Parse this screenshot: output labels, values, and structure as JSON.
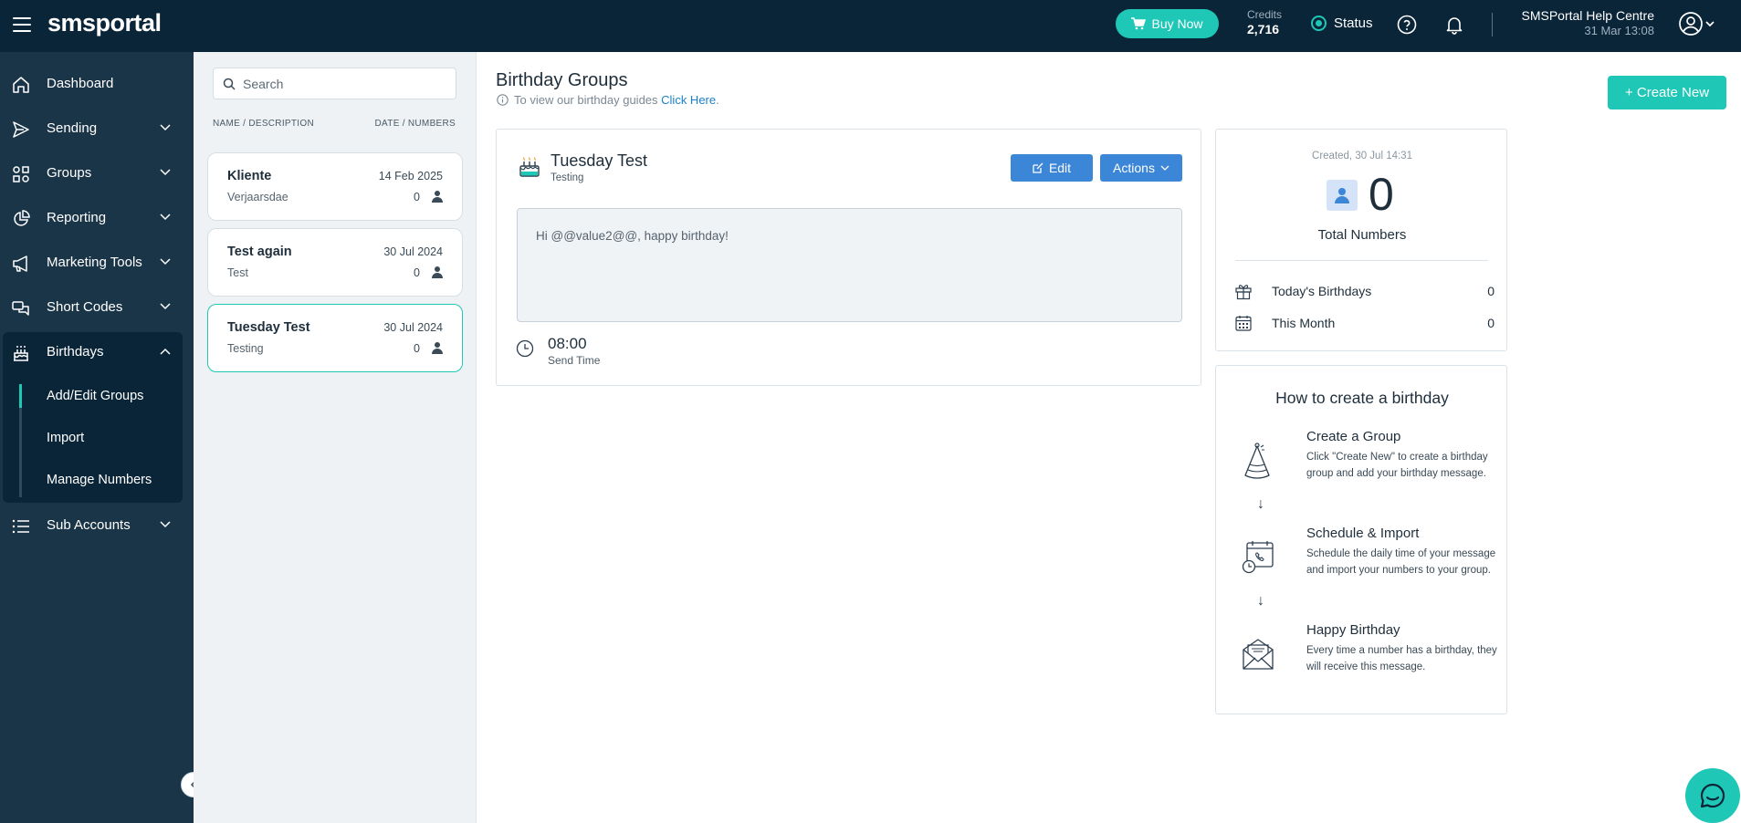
{
  "header": {
    "logo": "smsportal",
    "buy_now": "Buy Now",
    "credits_label": "Credits",
    "credits_value": "2,716",
    "status_label": "Status",
    "help_title": "SMSPortal Help Centre",
    "help_date": "31 Mar 13:08"
  },
  "sidebar": {
    "items": [
      {
        "label": "Dashboard",
        "icon": "home-icon"
      },
      {
        "label": "Sending",
        "icon": "send-icon"
      },
      {
        "label": "Groups",
        "icon": "groups-icon"
      },
      {
        "label": "Reporting",
        "icon": "pie-chart-icon"
      },
      {
        "label": "Marketing Tools",
        "icon": "megaphone-icon"
      },
      {
        "label": "Short Codes",
        "icon": "chat-icon"
      },
      {
        "label": "Birthdays",
        "icon": "cake-icon"
      },
      {
        "label": "Sub Accounts",
        "icon": "list-icon"
      }
    ],
    "birthday_sub": [
      {
        "label": "Add/Edit Groups",
        "active": true
      },
      {
        "label": "Import",
        "active": false
      },
      {
        "label": "Manage Numbers",
        "active": false
      }
    ]
  },
  "list": {
    "search_placeholder": "Search",
    "col_left": "NAME / DESCRIPTION",
    "col_right": "DATE / NUMBERS",
    "groups": [
      {
        "name": "Kliente",
        "date": "14 Feb 2025",
        "desc": "Verjaarsdae",
        "count": "0"
      },
      {
        "name": "Test again",
        "date": "30 Jul 2024",
        "desc": "Test",
        "count": "0"
      },
      {
        "name": "Tuesday Test",
        "date": "30 Jul 2024",
        "desc": "Testing",
        "count": "0",
        "selected": true
      }
    ]
  },
  "main": {
    "title": "Birthday Groups",
    "guide_text": "To view our birthday guides",
    "guide_link": "Click Here",
    "guide_end": ".",
    "create_new": "+ Create New"
  },
  "detail": {
    "name": "Tuesday Test",
    "desc": "Testing",
    "edit": "Edit",
    "actions": "Actions",
    "message": "Hi @@value2@@, happy birthday!",
    "send_time": "08:00",
    "send_time_label": "Send Time"
  },
  "stats": {
    "created": "Created, 30 Jul 14:31",
    "total": "0",
    "total_label": "Total Numbers",
    "today_label": "Today's Birthdays",
    "today_value": "0",
    "month_label": "This Month",
    "month_value": "0"
  },
  "howto": {
    "title": "How to create a birthday",
    "steps": [
      {
        "title": "Create a Group",
        "body": "Click \"Create New\" to create a birthday group and add your birthday message.",
        "icon": "party-hat-icon"
      },
      {
        "title": "Schedule & Import",
        "body": "Schedule the daily time of your message and import your numbers to your group.",
        "icon": "calendar-clock-icon"
      },
      {
        "title": "Happy Birthday",
        "body": "Every time a number has a birthday, they will receive this message.",
        "icon": "envelope-icon"
      }
    ],
    "arrow": "↓"
  },
  "colors": {
    "accent": "#1fc7b6",
    "topbar": "#0b2538",
    "sidebar": "#1b3548",
    "button_blue": "#3c86d8",
    "link": "#1b82c9"
  }
}
